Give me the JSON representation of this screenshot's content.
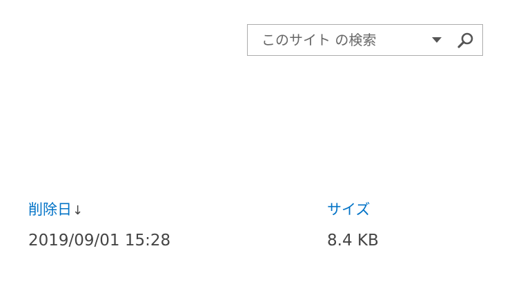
{
  "search": {
    "placeholder": "このサイト の検索",
    "value": "",
    "scope_icon": "caret-down-icon",
    "button_icon": "magnifier-icon"
  },
  "table": {
    "columns": [
      {
        "label": "削除日",
        "sort_indicator": "↓"
      },
      {
        "label": "サイズ"
      }
    ],
    "rows": [
      {
        "deleted": "2019/09/01 15:28",
        "size": "8.4 KB"
      }
    ]
  },
  "colors": {
    "link": "#0072c6",
    "text": "#444444",
    "border": "#ababab",
    "icon": "#555555"
  }
}
